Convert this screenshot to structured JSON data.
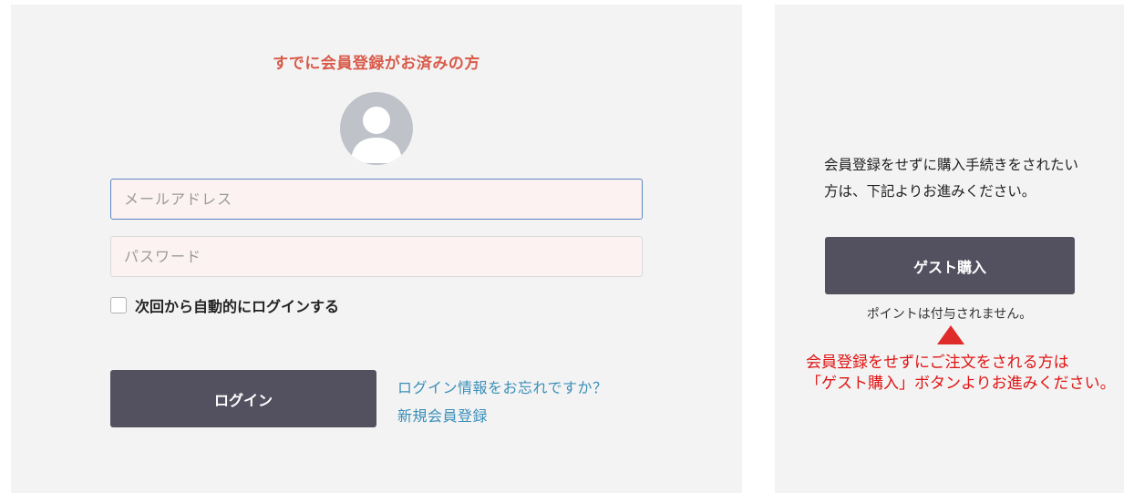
{
  "login": {
    "heading": "すでに会員登録がお済みの方",
    "email_placeholder": "メールアドレス",
    "password_placeholder": "パスワード",
    "remember_label": "次回から自動的にログインする",
    "login_button": "ログイン",
    "forgot_link": "ログイン情報をお忘れですか？",
    "register_link": "新規会員登録"
  },
  "guest": {
    "description": "会員登録をせずに購入手続きをされたい方は、下記よりお進みください。",
    "button": "ゲスト購入",
    "point_note": "ポイントは付与されません。",
    "warning_line1": "会員登録をせずにご注文をされる方は",
    "warning_line2": "「ゲスト購入」ボタンよりお進みください。"
  },
  "colors": {
    "heading_accent": "#d85a4a",
    "button_bg": "#53515f",
    "link": "#3a8fb8",
    "warning": "#e01414"
  },
  "icons": {
    "avatar": "user-avatar-icon",
    "arrow": "arrow-up-icon"
  }
}
